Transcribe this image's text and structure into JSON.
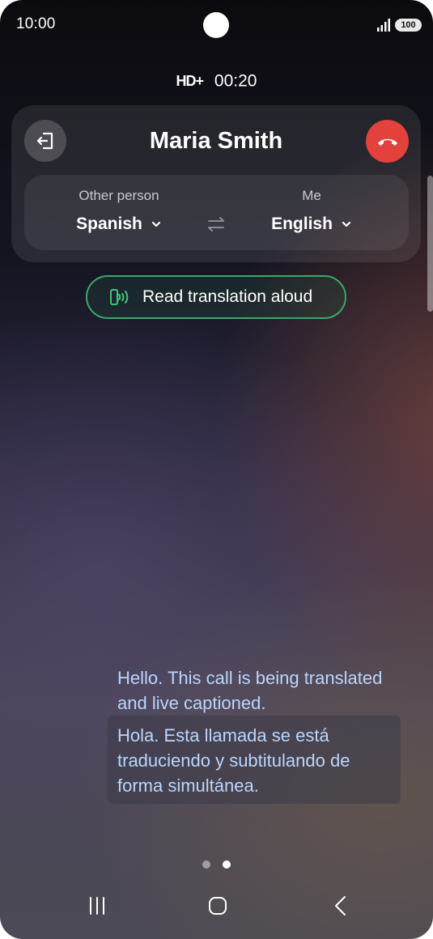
{
  "status_bar": {
    "time": "10:00",
    "battery": "100"
  },
  "call": {
    "hd_label": "HD+",
    "duration": "00:20",
    "caller_name": "Maria Smith"
  },
  "languages": {
    "other_label": "Other person",
    "other_language": "Spanish",
    "me_label": "Me",
    "my_language": "English"
  },
  "read_aloud": {
    "label": "Read translation aloud"
  },
  "captions": {
    "translated": "Hello. This call is being translated and live captioned.",
    "original": "Hola. Esta llamada se está traduciendo y subtitulando de forma simultánea."
  },
  "pager": {
    "page_count": 2,
    "current_page": 2
  },
  "colors": {
    "end_call": "#e3413c",
    "accent_green": "#3aa867",
    "caption_text": "#b9d6ff"
  },
  "icons": [
    "signal-icon",
    "exit-icon",
    "end-call-icon",
    "chevron-down-icon",
    "swap-icon",
    "speaker-wave-icon",
    "recents-icon",
    "home-icon",
    "back-icon"
  ]
}
